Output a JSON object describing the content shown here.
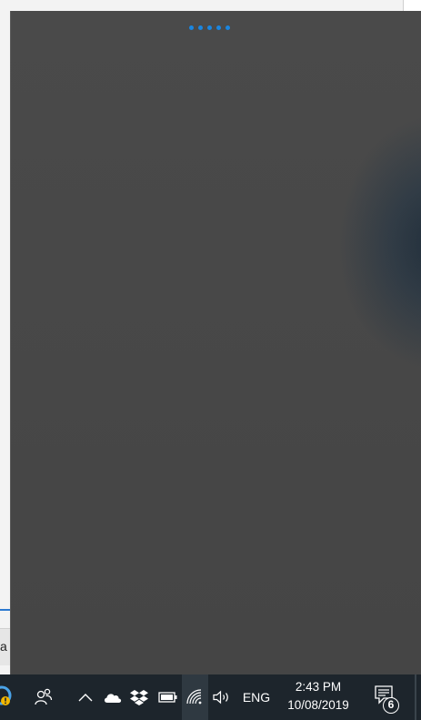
{
  "background_window": {
    "input_text": "a"
  },
  "flyout": {
    "state": "loading",
    "accent_color": "#1a86e0",
    "background_color": "#474747"
  },
  "taskbar": {
    "icons": [
      "app-icon-with-warning",
      "people-icon",
      "show-hidden-icons-chevron",
      "onedrive-icon",
      "dropbox-icon",
      "battery-icon",
      "wifi-icon",
      "volume-icon"
    ],
    "language": "ENG",
    "time": "2:43 PM",
    "date": "10/08/2019",
    "notification_count": "6",
    "background_color": "#1d252c"
  }
}
